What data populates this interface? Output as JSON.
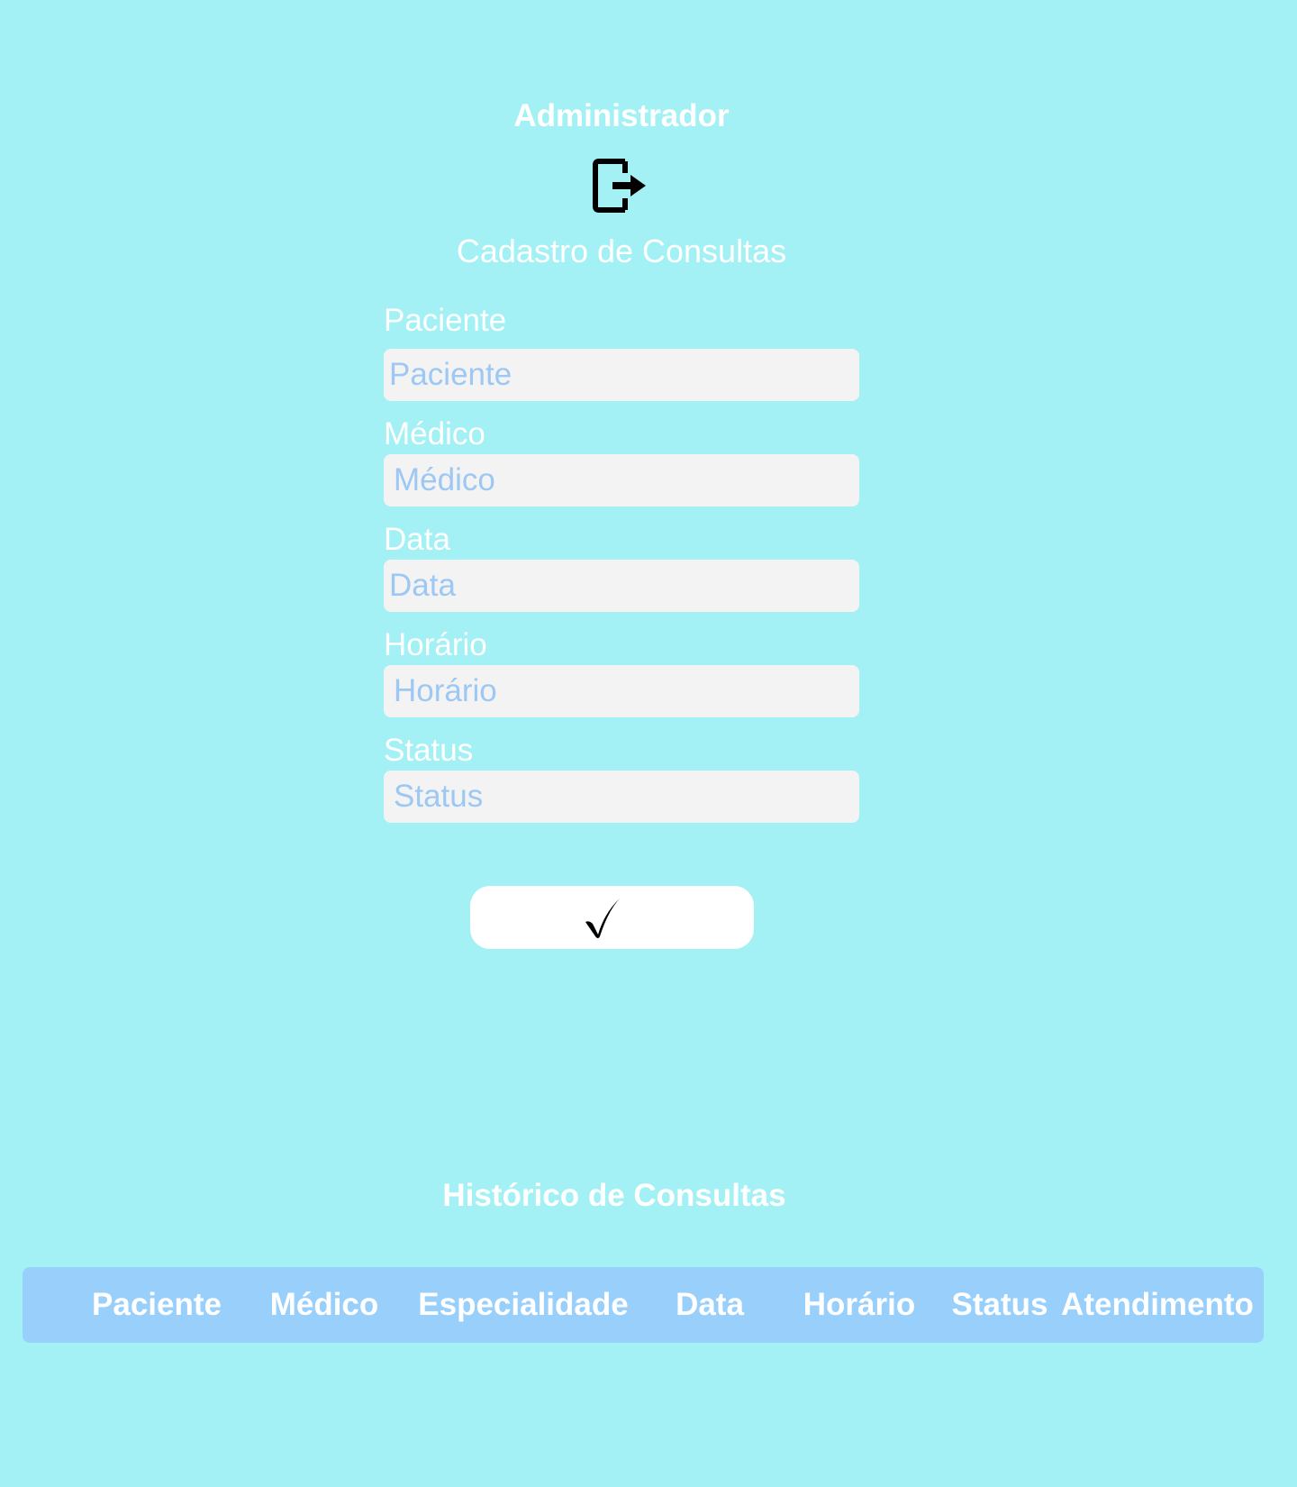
{
  "header": {
    "role_title": "Administrador",
    "logout_icon": "logout-icon"
  },
  "form": {
    "title": "Cadastro de Consultas",
    "fields": [
      {
        "label": "Paciente",
        "placeholder": "Paciente",
        "value": ""
      },
      {
        "label": "Médico",
        "placeholder": "Médico",
        "value": ""
      },
      {
        "label": "Data",
        "placeholder": "Data",
        "value": ""
      },
      {
        "label": "Horário",
        "placeholder": "Horário",
        "value": ""
      },
      {
        "label": "Status",
        "placeholder": "Status",
        "value": ""
      }
    ],
    "submit_icon": "checkmark-icon"
  },
  "history": {
    "title": "Histórico de Consultas",
    "columns": [
      "Paciente",
      "Médico",
      "Especialidade",
      "Data",
      "Horário",
      "Status",
      "Atendimento"
    ],
    "rows": []
  },
  "colors": {
    "background": "#a3f1f5",
    "input_background": "#f4f3f4",
    "placeholder": "#9cc8f3",
    "table_header": "#98cffb",
    "text": "#ffffff"
  }
}
